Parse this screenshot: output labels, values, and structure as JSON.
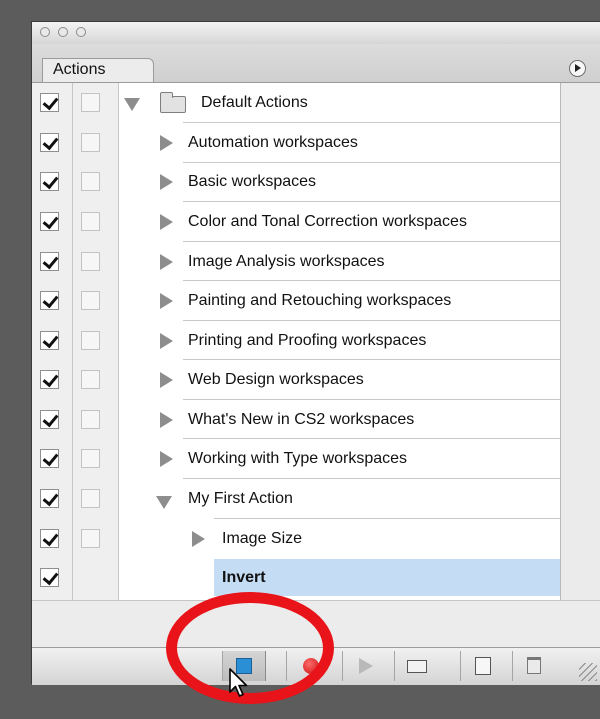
{
  "panel": {
    "tab_label": "Actions",
    "default_set": {
      "label": "Default Actions"
    },
    "actions": [
      {
        "label": "Automation workspaces"
      },
      {
        "label": "Basic workspaces"
      },
      {
        "label": "Color and Tonal Correction workspaces"
      },
      {
        "label": "Image Analysis workspaces"
      },
      {
        "label": "Painting and Retouching workspaces"
      },
      {
        "label": "Printing and Proofing workspaces"
      },
      {
        "label": "Web Design workspaces"
      },
      {
        "label": "What's New in CS2 workspaces"
      },
      {
        "label": "Working with Type workspaces"
      },
      {
        "label": "My First Action"
      }
    ],
    "steps": [
      {
        "label": "Image Size"
      },
      {
        "label": "Invert",
        "selected": true
      }
    ],
    "icons": {
      "menu": "panel-menu-icon",
      "stop": "stop-square-icon",
      "record": "record-circle-icon",
      "play": "play-triangle-icon",
      "new_set": "folder-icon",
      "new_action": "new-page-icon",
      "delete": "trash-icon"
    },
    "colors": {
      "selection": "#c5dcf5",
      "stop_icon": "#2b8fd6",
      "record_icon": "#d61a1a",
      "annotation_circle": "#e8141a"
    }
  }
}
